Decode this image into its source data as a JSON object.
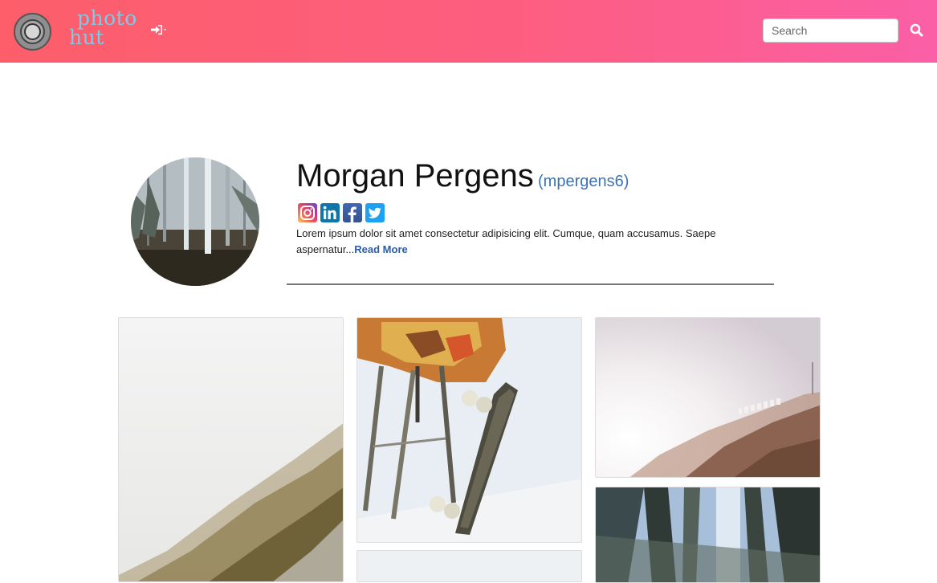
{
  "navbar": {
    "brand_line1": "photo",
    "brand_line2": "hut",
    "search": {
      "placeholder": "Search",
      "value": ""
    },
    "colors": {
      "gradient_start": "#fd5e6a",
      "gradient_end": "#fb5fa6",
      "brand_text": "#7ec9e6"
    },
    "icons": {
      "logo": "camera-lens-logo",
      "login": "sign-in-icon",
      "search": "search-icon"
    }
  },
  "profile": {
    "name": "Morgan Pergens",
    "handle": "(mpergens6)",
    "bio": "Lorem ipsum dolor sit amet consectetur adipisicing elit. Cumque, quam accusamus. Saepe aspernatur...",
    "read_more": "Read More",
    "socials": [
      {
        "name": "instagram",
        "icon": "instagram-icon"
      },
      {
        "name": "linkedin",
        "icon": "linkedin-icon"
      },
      {
        "name": "facebook",
        "icon": "facebook-icon"
      },
      {
        "name": "twitter",
        "icon": "twitter-icon"
      }
    ]
  },
  "gallery": {
    "photos": [
      {
        "subject": "foggy forest hillside"
      },
      {
        "subject": "stool with patterned blanket and skateboard"
      },
      {
        "subject": "hollywood sign hillside"
      },
      {
        "subject": "tall trees forest"
      },
      {
        "subject": "light photo"
      }
    ]
  }
}
